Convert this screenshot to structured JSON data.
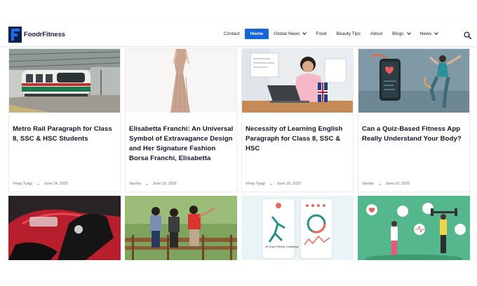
{
  "site": {
    "name": "FoodrFitness"
  },
  "nav": {
    "items": [
      {
        "label": "Contact",
        "active": false,
        "dropdown": false
      },
      {
        "label": "Home",
        "active": true,
        "dropdown": false
      },
      {
        "label": "Global News",
        "active": false,
        "dropdown": true
      },
      {
        "label": "Food",
        "active": false,
        "dropdown": false
      },
      {
        "label": "Beauty Tips",
        "active": false,
        "dropdown": false
      },
      {
        "label": "About",
        "active": false,
        "dropdown": false
      },
      {
        "label": "Blogs",
        "active": false,
        "dropdown": true
      },
      {
        "label": "News",
        "active": false,
        "dropdown": true
      }
    ],
    "search_icon": "search-icon",
    "active_color": "#1565d8"
  },
  "posts": [
    {
      "title": "Metro Rail Paragraph for Class 8, SSC & HSC Students",
      "author": "Vinay Tyagi",
      "date": "June 24, 2025",
      "image": "metro-train"
    },
    {
      "title": "Elisabetta Franchi: An Universal Symbol of Extravagance Design and Her Signature Fashion Borsa Franchi, Elisabetta",
      "author": "Varsha",
      "date": "June 23, 2025",
      "image": "fashion-dress"
    },
    {
      "title": "Necessity of Learning English Paragraph for Class 8, SSC & HSC",
      "author": "Vinay Tyagi",
      "date": "June 18, 2025",
      "image": "woman-laptop"
    },
    {
      "title": "Can a Quiz-Based Fitness App Really Understand Your Body?",
      "author": "Varsha",
      "date": "June 10, 2025",
      "image": "fitness-app"
    }
  ],
  "more_posts": [
    {
      "image": "car-glove"
    },
    {
      "image": "friends-bench"
    },
    {
      "image": "fitness-challenge-app",
      "caption": "30 Days Fitness Challenge"
    },
    {
      "image": "fitness-illustration"
    }
  ]
}
